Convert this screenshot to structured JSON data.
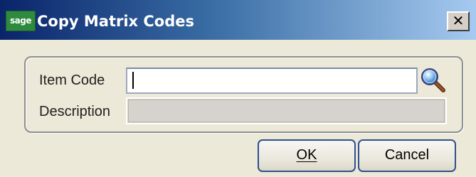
{
  "window": {
    "title": "Copy Matrix Codes",
    "logo_text": "sage",
    "close_glyph": "✕"
  },
  "form": {
    "item_code": {
      "label": "Item Code",
      "value": ""
    },
    "description": {
      "label": "Description",
      "value": ""
    },
    "lookup_icon": "magnifier-icon"
  },
  "buttons": {
    "ok": {
      "label": "OK",
      "accelerator": "O"
    },
    "cancel": {
      "label": "Cancel",
      "accelerator": "C"
    }
  },
  "colors": {
    "titlebar_start": "#0a246a",
    "titlebar_end": "#a6caf0",
    "dialog_bg": "#ece9d8",
    "brand": "#2e8b3e"
  }
}
